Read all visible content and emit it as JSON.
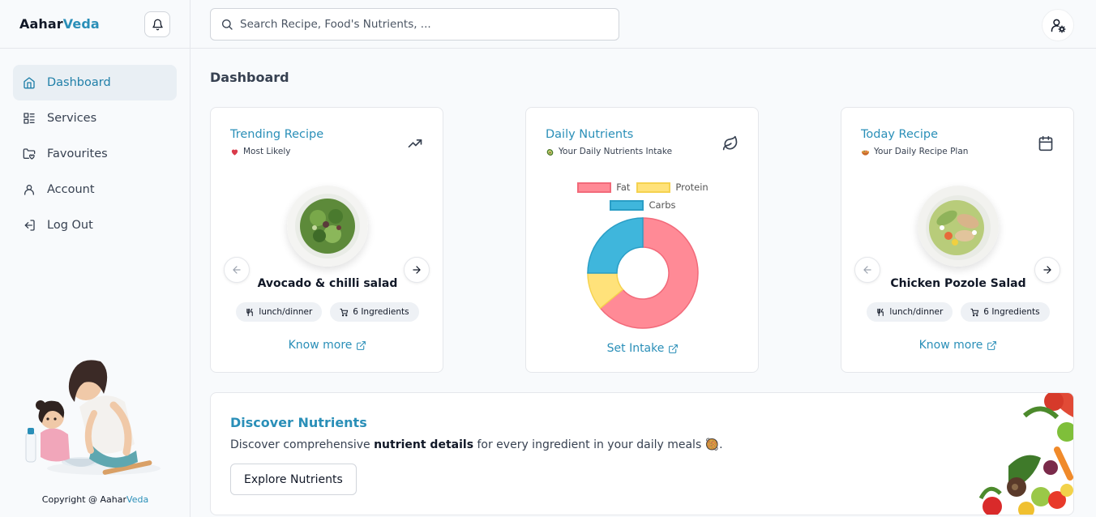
{
  "brand": {
    "part1": "Aahar",
    "part2": "Veda"
  },
  "sidebar": {
    "items": [
      {
        "label": "Dashboard",
        "icon": "home-icon",
        "active": true
      },
      {
        "label": "Services",
        "icon": "services-icon",
        "active": false
      },
      {
        "label": "Favourites",
        "icon": "folder-heart-icon",
        "active": false
      },
      {
        "label": "Account",
        "icon": "user-icon",
        "active": false
      },
      {
        "label": "Log Out",
        "icon": "logout-icon",
        "active": false
      }
    ],
    "copyright_prefix": "Copyright @ ",
    "copyright_brand1": "Aahar",
    "copyright_brand2": "Veda"
  },
  "search": {
    "placeholder": "Search Recipe, Food's Nutrients, ..."
  },
  "page_title": "Dashboard",
  "cards": {
    "trending": {
      "title": "Trending Recipe",
      "subtitle": "Most Likely",
      "dish": "Avocado & chilli salad",
      "tags": [
        "lunch/dinner",
        "6 Ingredients"
      ],
      "link": "Know more"
    },
    "nutrients": {
      "title": "Daily Nutrients",
      "subtitle": "Your Daily Nutrients Intake",
      "link": "Set Intake"
    },
    "today": {
      "title": "Today Recipe",
      "subtitle": "Your Daily Recipe Plan",
      "dish": "Chicken Pozole Salad",
      "tags": [
        "lunch/dinner",
        "6 Ingredients"
      ],
      "link": "Know more"
    }
  },
  "chart_data": {
    "type": "pie",
    "donut": true,
    "categories": [
      "Fat",
      "Protein",
      "Carbs"
    ],
    "values": [
      64,
      11,
      25
    ],
    "colors": [
      "#ff8a96",
      "#ffe27a",
      "#3fb6dc"
    ],
    "borders": [
      "#f26a7a",
      "#f5d24f",
      "#2a9ec6"
    ],
    "legend_position": "top"
  },
  "discover": {
    "title": "Discover Nutrients",
    "text_before": "Discover comprehensive ",
    "text_bold": "nutrient details",
    "text_after": " for every ingredient in your daily meals 🥘.",
    "button": "Explore Nutrients"
  },
  "colors": {
    "accent": "#2a8fb8",
    "active_bg": "#e9eff4"
  }
}
